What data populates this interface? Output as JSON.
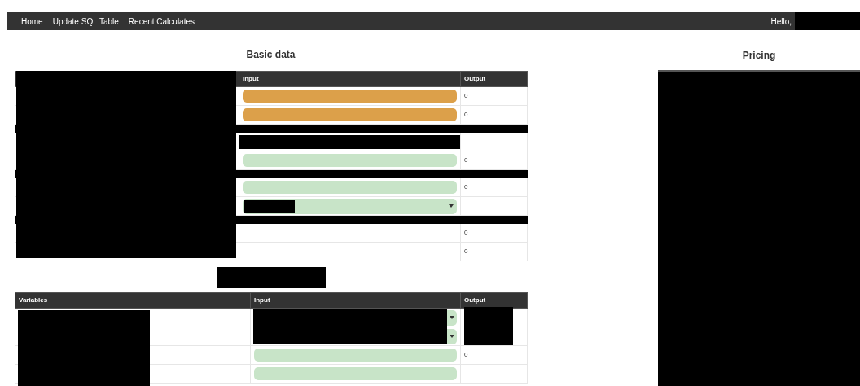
{
  "navbar": {
    "links": [
      {
        "label": "Home"
      },
      {
        "label": "Update SQL Table"
      },
      {
        "label": "Recent Calculates"
      }
    ],
    "greeting": "Hello,",
    "user_redacted": true
  },
  "basic_data": {
    "title": "Basic data",
    "label_column_redacted": true,
    "columns": [
      "",
      "Input",
      "Output"
    ],
    "rows": [
      {
        "kind": "input",
        "color": "#dca04a",
        "output": "0"
      },
      {
        "kind": "input",
        "color": "#dca04a",
        "output": "0"
      },
      {
        "kind": "redacted"
      },
      {
        "kind": "redacted-input"
      },
      {
        "kind": "input",
        "color": "#c8e4c8",
        "output": "0"
      },
      {
        "kind": "redacted"
      },
      {
        "kind": "input",
        "color": "#c8e4c8",
        "output": "0"
      },
      {
        "kind": "select",
        "color": "#c8e4c8",
        "redacted": true
      },
      {
        "kind": "redacted"
      },
      {
        "kind": "blank",
        "output": "0"
      },
      {
        "kind": "blank",
        "output": "0"
      }
    ]
  },
  "variables": {
    "title_redacted": true,
    "label_column_redacted": true,
    "columns": [
      "Variables",
      "Input",
      "Output"
    ],
    "rows": [
      {
        "kind": "select",
        "color": "#c8e4c8",
        "redacted": true
      },
      {
        "kind": "select",
        "color": "#c8e4c8",
        "redacted": true
      },
      {
        "kind": "input",
        "color": "#c8e4c8",
        "output": "0"
      },
      {
        "kind": "input",
        "color": "#c8e4c8"
      }
    ]
  },
  "pricing": {
    "title": "Pricing",
    "table_redacted": true
  }
}
